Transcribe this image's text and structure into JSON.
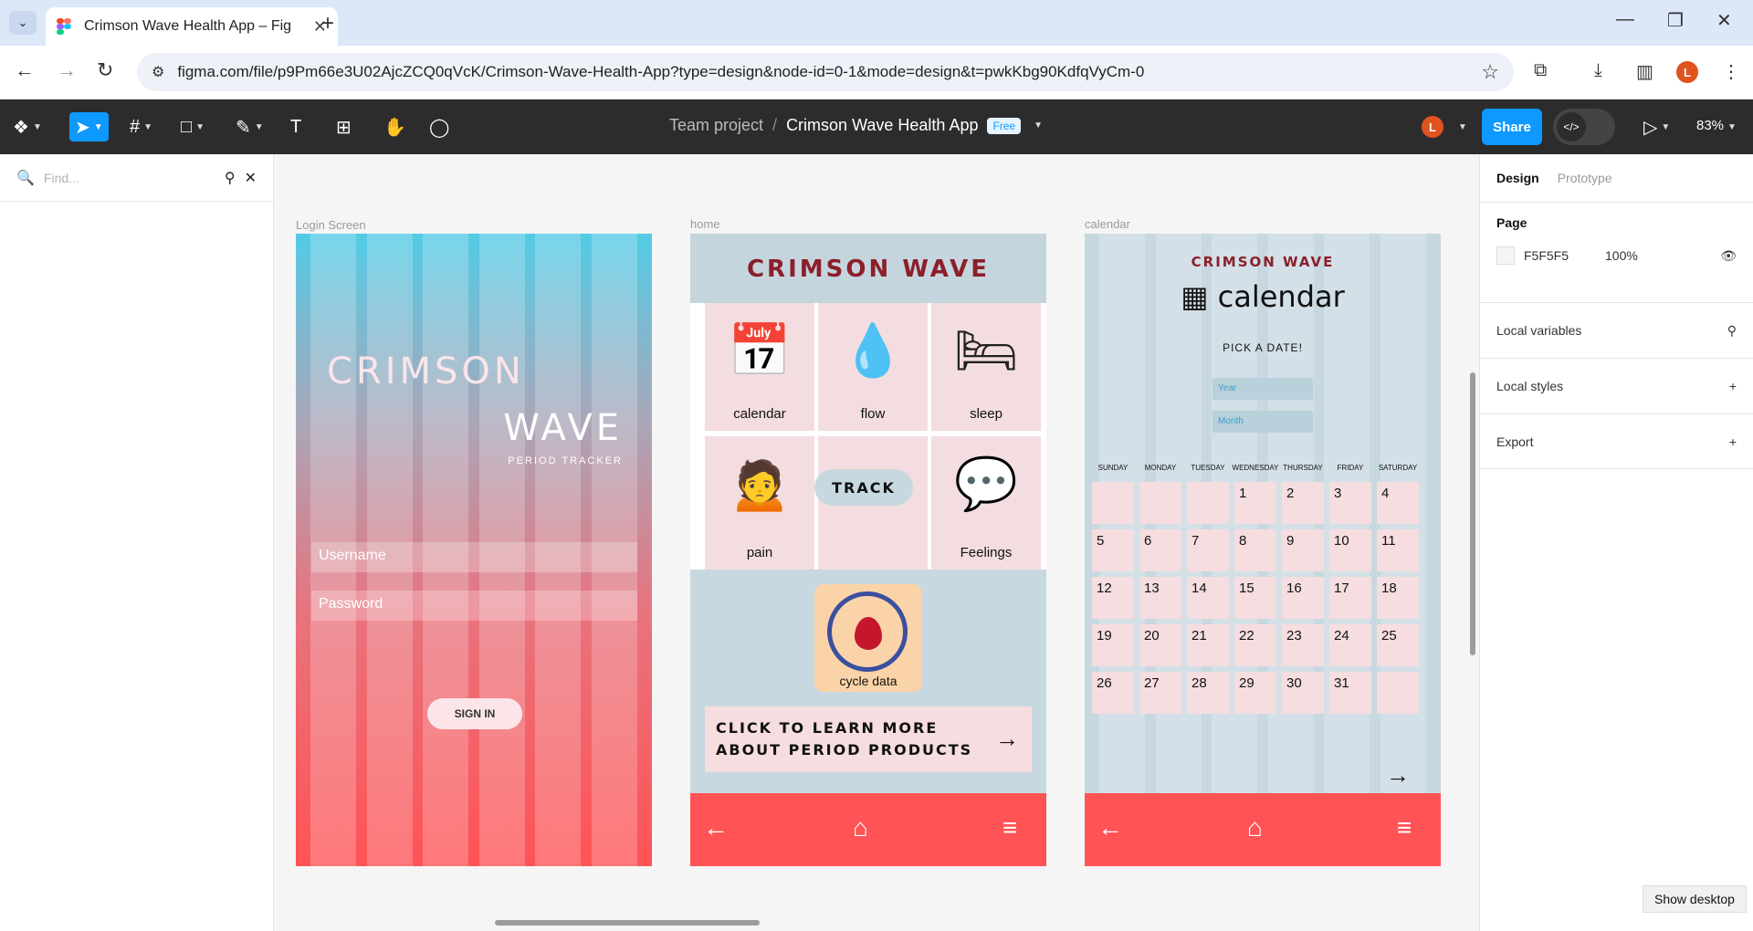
{
  "browser": {
    "tab_title": "Crimson Wave Health App – Fig",
    "url": "figma.com/file/p9Pm66e3U02AjcZCQ0qVcK/Crimson-Wave-Health-App?type=design&node-id=0-1&mode=design&t=pwkKbg90KdfqVyCm-0",
    "avatar_letter": "L"
  },
  "figma": {
    "team": "Team project",
    "file": "Crimson Wave Health App",
    "plan_badge": "Free",
    "share_label": "Share",
    "zoom": "83%",
    "user_initial": "L"
  },
  "left_panel": {
    "find_placeholder": "Find..."
  },
  "frames": {
    "login": {
      "label": "Login Screen",
      "brand_line1": "CRIMSON",
      "brand_line2": "WAVE",
      "tagline": "PERIOD TRACKER",
      "username_placeholder": "Username",
      "password_placeholder": "Password",
      "signin_label": "SIGN IN"
    },
    "home": {
      "label": "home",
      "title": "CRIMSON WAVE",
      "tiles": [
        "calendar",
        "flow",
        "sleep",
        "pain",
        "Feelings"
      ],
      "track_label": "TRACK",
      "cycle_label": "cycle data",
      "learn_text": "CLICK TO LEARN MORE ABOUT PERIOD PRODUCTS"
    },
    "calendar": {
      "label": "calendar",
      "brand": "CRIMSON WAVE",
      "heading": "calendar",
      "pick": "PICK A DATE!",
      "year_placeholder": "Year",
      "month_placeholder": "Month",
      "weekdays": [
        "SUNDAY",
        "MONDAY",
        "TUESDAY",
        "WEDNESDAY",
        "THURSDAY",
        "FRIDAY",
        "SATURDAY"
      ],
      "days": [
        "",
        "",
        "",
        "1",
        "2",
        "3",
        "4",
        "5",
        "6",
        "7",
        "8",
        "9",
        "10",
        "11",
        "12",
        "13",
        "14",
        "15",
        "16",
        "17",
        "18",
        "19",
        "20",
        "21",
        "22",
        "23",
        "24",
        "25",
        "26",
        "27",
        "28",
        "29",
        "30",
        "31",
        ""
      ]
    }
  },
  "right_panel": {
    "tab_design": "Design",
    "tab_prototype": "Prototype",
    "page_heading": "Page",
    "page_color": "F5F5F5",
    "page_opacity": "100%",
    "local_variables": "Local variables",
    "local_styles": "Local styles",
    "export": "Export"
  },
  "taskbar": {
    "show_desktop": "Show desktop"
  }
}
